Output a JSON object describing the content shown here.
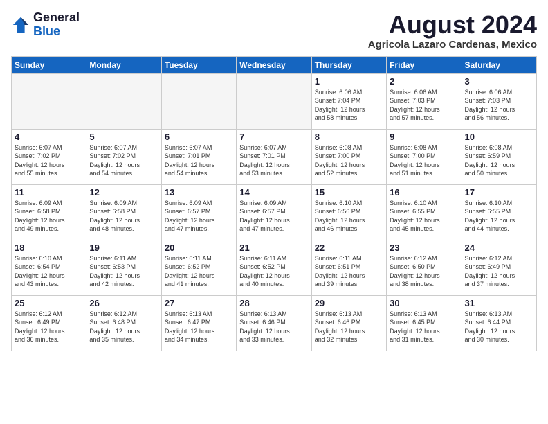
{
  "header": {
    "logo_general": "General",
    "logo_blue": "Blue",
    "month": "August 2024",
    "location": "Agricola Lazaro Cardenas, Mexico"
  },
  "weekdays": [
    "Sunday",
    "Monday",
    "Tuesday",
    "Wednesday",
    "Thursday",
    "Friday",
    "Saturday"
  ],
  "weeks": [
    [
      {
        "day": "",
        "info": ""
      },
      {
        "day": "",
        "info": ""
      },
      {
        "day": "",
        "info": ""
      },
      {
        "day": "",
        "info": ""
      },
      {
        "day": "1",
        "info": "Sunrise: 6:06 AM\nSunset: 7:04 PM\nDaylight: 12 hours\nand 58 minutes."
      },
      {
        "day": "2",
        "info": "Sunrise: 6:06 AM\nSunset: 7:03 PM\nDaylight: 12 hours\nand 57 minutes."
      },
      {
        "day": "3",
        "info": "Sunrise: 6:06 AM\nSunset: 7:03 PM\nDaylight: 12 hours\nand 56 minutes."
      }
    ],
    [
      {
        "day": "4",
        "info": "Sunrise: 6:07 AM\nSunset: 7:02 PM\nDaylight: 12 hours\nand 55 minutes."
      },
      {
        "day": "5",
        "info": "Sunrise: 6:07 AM\nSunset: 7:02 PM\nDaylight: 12 hours\nand 54 minutes."
      },
      {
        "day": "6",
        "info": "Sunrise: 6:07 AM\nSunset: 7:01 PM\nDaylight: 12 hours\nand 54 minutes."
      },
      {
        "day": "7",
        "info": "Sunrise: 6:07 AM\nSunset: 7:01 PM\nDaylight: 12 hours\nand 53 minutes."
      },
      {
        "day": "8",
        "info": "Sunrise: 6:08 AM\nSunset: 7:00 PM\nDaylight: 12 hours\nand 52 minutes."
      },
      {
        "day": "9",
        "info": "Sunrise: 6:08 AM\nSunset: 7:00 PM\nDaylight: 12 hours\nand 51 minutes."
      },
      {
        "day": "10",
        "info": "Sunrise: 6:08 AM\nSunset: 6:59 PM\nDaylight: 12 hours\nand 50 minutes."
      }
    ],
    [
      {
        "day": "11",
        "info": "Sunrise: 6:09 AM\nSunset: 6:58 PM\nDaylight: 12 hours\nand 49 minutes."
      },
      {
        "day": "12",
        "info": "Sunrise: 6:09 AM\nSunset: 6:58 PM\nDaylight: 12 hours\nand 48 minutes."
      },
      {
        "day": "13",
        "info": "Sunrise: 6:09 AM\nSunset: 6:57 PM\nDaylight: 12 hours\nand 47 minutes."
      },
      {
        "day": "14",
        "info": "Sunrise: 6:09 AM\nSunset: 6:57 PM\nDaylight: 12 hours\nand 47 minutes."
      },
      {
        "day": "15",
        "info": "Sunrise: 6:10 AM\nSunset: 6:56 PM\nDaylight: 12 hours\nand 46 minutes."
      },
      {
        "day": "16",
        "info": "Sunrise: 6:10 AM\nSunset: 6:55 PM\nDaylight: 12 hours\nand 45 minutes."
      },
      {
        "day": "17",
        "info": "Sunrise: 6:10 AM\nSunset: 6:55 PM\nDaylight: 12 hours\nand 44 minutes."
      }
    ],
    [
      {
        "day": "18",
        "info": "Sunrise: 6:10 AM\nSunset: 6:54 PM\nDaylight: 12 hours\nand 43 minutes."
      },
      {
        "day": "19",
        "info": "Sunrise: 6:11 AM\nSunset: 6:53 PM\nDaylight: 12 hours\nand 42 minutes."
      },
      {
        "day": "20",
        "info": "Sunrise: 6:11 AM\nSunset: 6:52 PM\nDaylight: 12 hours\nand 41 minutes."
      },
      {
        "day": "21",
        "info": "Sunrise: 6:11 AM\nSunset: 6:52 PM\nDaylight: 12 hours\nand 40 minutes."
      },
      {
        "day": "22",
        "info": "Sunrise: 6:11 AM\nSunset: 6:51 PM\nDaylight: 12 hours\nand 39 minutes."
      },
      {
        "day": "23",
        "info": "Sunrise: 6:12 AM\nSunset: 6:50 PM\nDaylight: 12 hours\nand 38 minutes."
      },
      {
        "day": "24",
        "info": "Sunrise: 6:12 AM\nSunset: 6:49 PM\nDaylight: 12 hours\nand 37 minutes."
      }
    ],
    [
      {
        "day": "25",
        "info": "Sunrise: 6:12 AM\nSunset: 6:49 PM\nDaylight: 12 hours\nand 36 minutes."
      },
      {
        "day": "26",
        "info": "Sunrise: 6:12 AM\nSunset: 6:48 PM\nDaylight: 12 hours\nand 35 minutes."
      },
      {
        "day": "27",
        "info": "Sunrise: 6:13 AM\nSunset: 6:47 PM\nDaylight: 12 hours\nand 34 minutes."
      },
      {
        "day": "28",
        "info": "Sunrise: 6:13 AM\nSunset: 6:46 PM\nDaylight: 12 hours\nand 33 minutes."
      },
      {
        "day": "29",
        "info": "Sunrise: 6:13 AM\nSunset: 6:46 PM\nDaylight: 12 hours\nand 32 minutes."
      },
      {
        "day": "30",
        "info": "Sunrise: 6:13 AM\nSunset: 6:45 PM\nDaylight: 12 hours\nand 31 minutes."
      },
      {
        "day": "31",
        "info": "Sunrise: 6:13 AM\nSunset: 6:44 PM\nDaylight: 12 hours\nand 30 minutes."
      }
    ]
  ]
}
